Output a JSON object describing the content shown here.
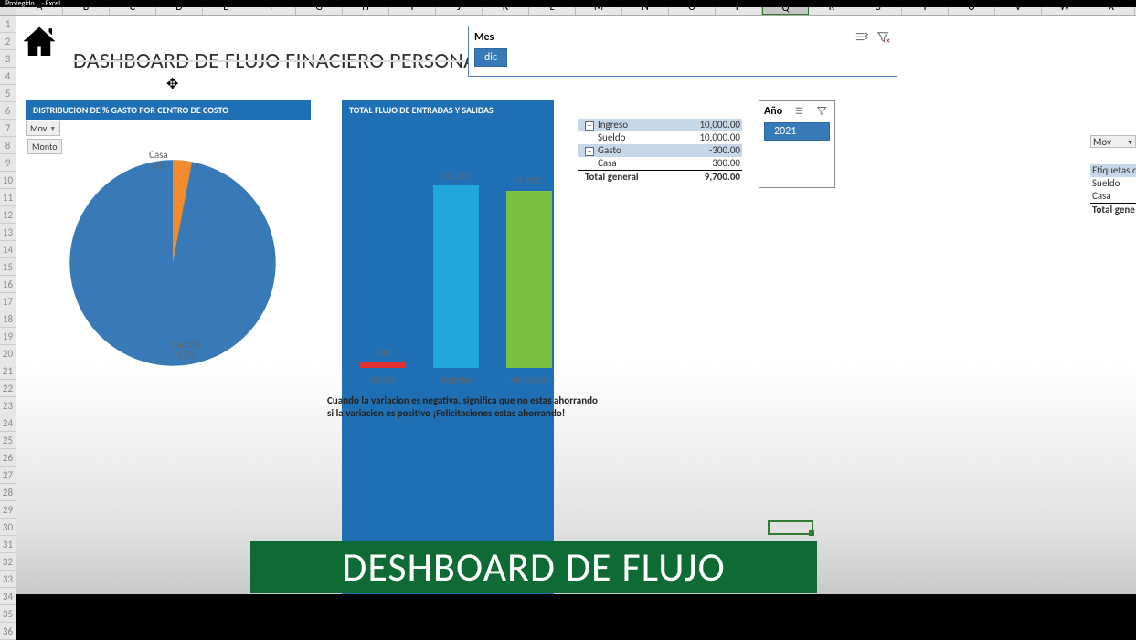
{
  "window": {
    "title_fragment": "Protegido... - Excel"
  },
  "columns": [
    "A",
    "B",
    "C",
    "D",
    "E",
    "F",
    "G",
    "H",
    "I",
    "J",
    "K",
    "L",
    "M",
    "N",
    "O",
    "P",
    "Q",
    "R",
    "S",
    "T",
    "U",
    "V",
    "W",
    "X"
  ],
  "active_column_index": 16,
  "rows_visible": 36,
  "header": {
    "title": "DASHBOARD DE FLUJO FINACIERO PERSONAL"
  },
  "slicer_mes": {
    "label": "Mes",
    "selected": "dic"
  },
  "slicer_ano": {
    "label": "Año",
    "selected": "2021"
  },
  "pie_section": {
    "header": "DISTRIBUCION DE % GASTO POR CENTRO DE COSTO",
    "dropdown_mov": "Mov",
    "dropdown_monto": "Monto"
  },
  "bar_section": {
    "header": "TOTAL FLUJO DE ENTRADAS Y SALIDAS"
  },
  "bar_note_1": "Cuando la variacion es negativa, significa que no estas ahorrando",
  "bar_note_2": "si la variacion es positivo ¡Felicitaciones estas ahorrando!",
  "pivot": {
    "rows": [
      {
        "type": "group",
        "label": "Ingreso",
        "value": "10,000.00"
      },
      {
        "type": "leaf",
        "label": "Sueldo",
        "value": "10,000.00"
      },
      {
        "type": "group",
        "label": "Gasto",
        "value": "-300.00"
      },
      {
        "type": "leaf",
        "label": "Casa",
        "value": "-300.00"
      },
      {
        "type": "total",
        "label": "Total general",
        "value": "9,700.00"
      }
    ]
  },
  "right_pivot": {
    "dd": "Mov",
    "rows": [
      "Etiquetas d",
      "Sueldo",
      "Casa",
      "Total gene"
    ]
  },
  "banner": "DESHBOARD DE FLUJO",
  "chart_data": [
    {
      "type": "pie",
      "title": "DISTRIBUCION DE % GASTO POR CENTRO DE COSTO",
      "series": [
        {
          "name": "Sueldo",
          "value": 97,
          "label": "Sueldo\n97%",
          "color": "#3879b7"
        },
        {
          "name": "Casa",
          "value": -3,
          "label": "Casa\n-3%",
          "color": "#f08c2e"
        }
      ]
    },
    {
      "type": "bar",
      "title": "TOTAL FLUJO DE ENTRADAS Y SALIDAS",
      "categories": [
        "Gasto",
        "Ingreso",
        "Variacion"
      ],
      "values": [
        300,
        10000,
        9700
      ],
      "colors": [
        "#e03131",
        "#1fa8d8",
        "#7bc043"
      ],
      "ylim": [
        0,
        10000
      ]
    }
  ]
}
